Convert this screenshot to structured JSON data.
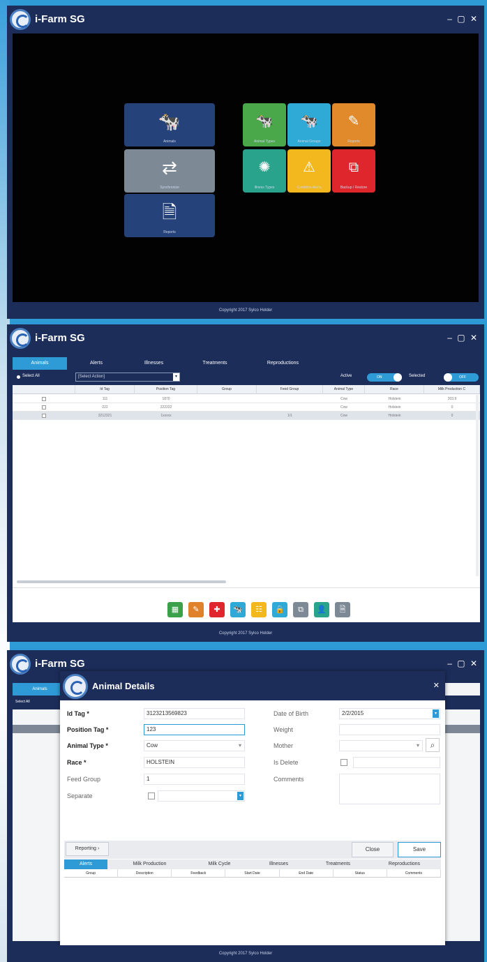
{
  "app": {
    "title": "i-Farm SG",
    "window_controls": "– ▢ ✕",
    "copyright": "Copyright 2017 Sylco Holder"
  },
  "dashboard": {
    "left_tiles": [
      {
        "label": "Animals",
        "icon": "cow-icon",
        "glyph": "🐄",
        "color": "#25437a"
      },
      {
        "label": "Synchronize",
        "icon": "sync-devices-icon",
        "glyph": "⇄",
        "color": "#7d8a96"
      },
      {
        "label": "Reports",
        "icon": "report-search-icon",
        "glyph": "🗎",
        "color": "#25437a"
      }
    ],
    "right_tiles": [
      {
        "label": "Animal Types",
        "icon": "animal-types-icon",
        "glyph": "🐄",
        "color": "#4aa84a"
      },
      {
        "label": "Animal Groups",
        "icon": "animal-groups-icon",
        "glyph": "🐄",
        "color": "#2fa9d6"
      },
      {
        "label": "Reports",
        "icon": "edit-doc-icon",
        "glyph": "✎",
        "color": "#e08a2c"
      },
      {
        "label": "Illness Types",
        "icon": "virus-icon",
        "glyph": "✺",
        "color": "#2aa38c"
      },
      {
        "label": "Condition Alerts",
        "icon": "warning-icon",
        "glyph": "⚠",
        "color": "#f2b81d"
      },
      {
        "label": "Backup / Restore",
        "icon": "copy-docs-icon",
        "glyph": "⧉",
        "color": "#e0262d"
      }
    ]
  },
  "list": {
    "tabs": [
      "Animals",
      "Alerts",
      "Illnesses",
      "Treatments",
      "Reproductions"
    ],
    "select_all": "Select All",
    "actions_placeholder": "[Select Action]",
    "active_label": "Active",
    "active_toggle": "ON",
    "selected_label": "Selected",
    "selected_toggle": "OFF",
    "columns": [
      "",
      "Id Tag",
      "Position Tag",
      "Group",
      "Feed Group",
      "Animal Type",
      "Race",
      "Milk Production C"
    ],
    "rows": [
      [
        "",
        "111",
        "1870",
        "",
        "",
        "Cow",
        "Holstein",
        "203.9"
      ],
      [
        "",
        "222",
        "222222",
        "",
        "",
        "Cow",
        "Holstein",
        "0"
      ],
      [
        "",
        "3212321",
        "1xxxxx",
        "",
        "1/1",
        "Cow",
        "Holstein",
        "0"
      ]
    ],
    "action_buttons": [
      {
        "icon": "excel-icon",
        "glyph": "▦",
        "color": "#3aa14a"
      },
      {
        "icon": "edit-icon",
        "glyph": "✎",
        "color": "#e0822c"
      },
      {
        "icon": "add-icon",
        "glyph": "✚",
        "color": "#e0262d"
      },
      {
        "icon": "cow-icon",
        "glyph": "🐄",
        "color": "#2fa9d6"
      },
      {
        "icon": "feed-icon",
        "glyph": "☷",
        "color": "#f2b81d"
      },
      {
        "icon": "lock-icon",
        "glyph": "🔒",
        "color": "#2fa9d6"
      },
      {
        "icon": "copy-icon",
        "glyph": "⧉",
        "color": "#7d8a96"
      },
      {
        "icon": "user-icon",
        "glyph": "👤",
        "color": "#2aa38c"
      },
      {
        "icon": "report-icon",
        "glyph": "🗎",
        "color": "#7d8a96"
      }
    ]
  },
  "dialog": {
    "title": "Animal Details",
    "fields": {
      "id_tag": {
        "label": "Id Tag *",
        "value": "3123213569823"
      },
      "position_tag": {
        "label": "Position Tag *",
        "value": "123"
      },
      "animal_type": {
        "label": "Animal Type *",
        "value": "Cow"
      },
      "race": {
        "label": "Race *",
        "value": "HOLSTEIN"
      },
      "feed_group": {
        "label": "Feed Group",
        "value": "1"
      },
      "separate": {
        "label": "Separate"
      },
      "date_of_birth": {
        "label": "Date of Birth",
        "value": "2/2/2015"
      },
      "weight": {
        "label": "Weight",
        "value": ""
      },
      "mother": {
        "label": "Mother",
        "value": ""
      },
      "is_delete": {
        "label": "Is Delete"
      },
      "comments": {
        "label": "Comments",
        "value": ""
      }
    },
    "reporting_button": "Reporting ›",
    "close_button": "Close",
    "save_button": "Save",
    "subtabs": [
      "Alerts",
      "Milk Production",
      "Milk Cycle",
      "Illnesses",
      "Treatments",
      "Reproductions"
    ],
    "subcolumns": [
      "Group",
      "Description",
      "Feedback",
      "Start Date",
      "End Date",
      "Status",
      "Comments"
    ]
  }
}
